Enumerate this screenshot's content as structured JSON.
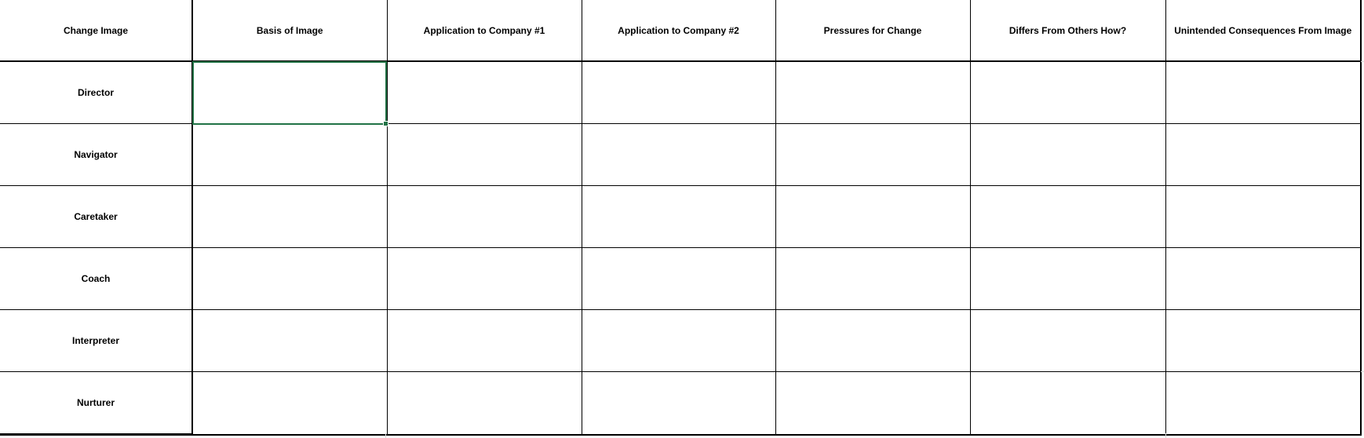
{
  "spreadsheet": {
    "columns": [
      "Change Image",
      "Basis of Image",
      "Application to Company #1",
      "Application to Company #2",
      "Pressures for Change",
      "Differs From Others How?",
      "Unintended Consequences From Image"
    ],
    "rows": [
      {
        "label": "Director",
        "cells": [
          "",
          "",
          "",
          "",
          "",
          ""
        ]
      },
      {
        "label": "Navigator",
        "cells": [
          "",
          "",
          "",
          "",
          "",
          ""
        ]
      },
      {
        "label": "Caretaker",
        "cells": [
          "",
          "",
          "",
          "",
          "",
          ""
        ]
      },
      {
        "label": "Coach",
        "cells": [
          "",
          "",
          "",
          "",
          "",
          ""
        ]
      },
      {
        "label": "Interpreter",
        "cells": [
          "",
          "",
          "",
          "",
          "",
          ""
        ]
      },
      {
        "label": "Nurturer",
        "cells": [
          "",
          "",
          "",
          "",
          "",
          ""
        ]
      }
    ],
    "selected_cell": {
      "row": "Director",
      "column": "Basis of Image"
    },
    "selection_color": "#217346"
  }
}
